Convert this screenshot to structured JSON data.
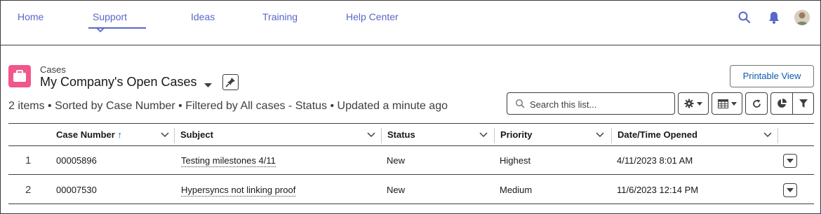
{
  "nav": {
    "items": [
      {
        "label": "Home"
      },
      {
        "label": "Support"
      },
      {
        "label": "Ideas"
      },
      {
        "label": "Training"
      },
      {
        "label": "Help Center"
      }
    ],
    "active": "Support"
  },
  "header": {
    "object_label": "Cases",
    "list_title": "My Company's Open Cases",
    "subtitle": "2 items • Sorted by Case Number • Filtered by All cases - Status • Updated a minute ago",
    "printable_view": "Printable View",
    "search_placeholder": "Search this list..."
  },
  "table": {
    "columns": [
      "Case Number",
      "Subject",
      "Status",
      "Priority",
      "Date/Time Opened"
    ],
    "sort_indicator": "↑",
    "rows": [
      {
        "num": "1",
        "case_number": "00005896",
        "subject": "Testing milestones 4/11",
        "status": "New",
        "priority": "Highest",
        "opened": "4/11/2023 8:01 AM"
      },
      {
        "num": "2",
        "case_number": "00007530",
        "subject": "Hypersyncs not linking proof",
        "status": "New",
        "priority": "Medium",
        "opened": "11/6/2023 12:14 PM"
      }
    ]
  },
  "colors": {
    "nav_link": "#5867c9",
    "cases_icon": "#f2568b",
    "button_text": "#0b5cab"
  },
  "icons": [
    "search-icon",
    "bell-icon",
    "avatar",
    "cases-icon",
    "pin-icon",
    "gear-icon",
    "table-icon",
    "refresh-icon",
    "chart-icon",
    "filter-icon",
    "chevron-down-icon"
  ]
}
